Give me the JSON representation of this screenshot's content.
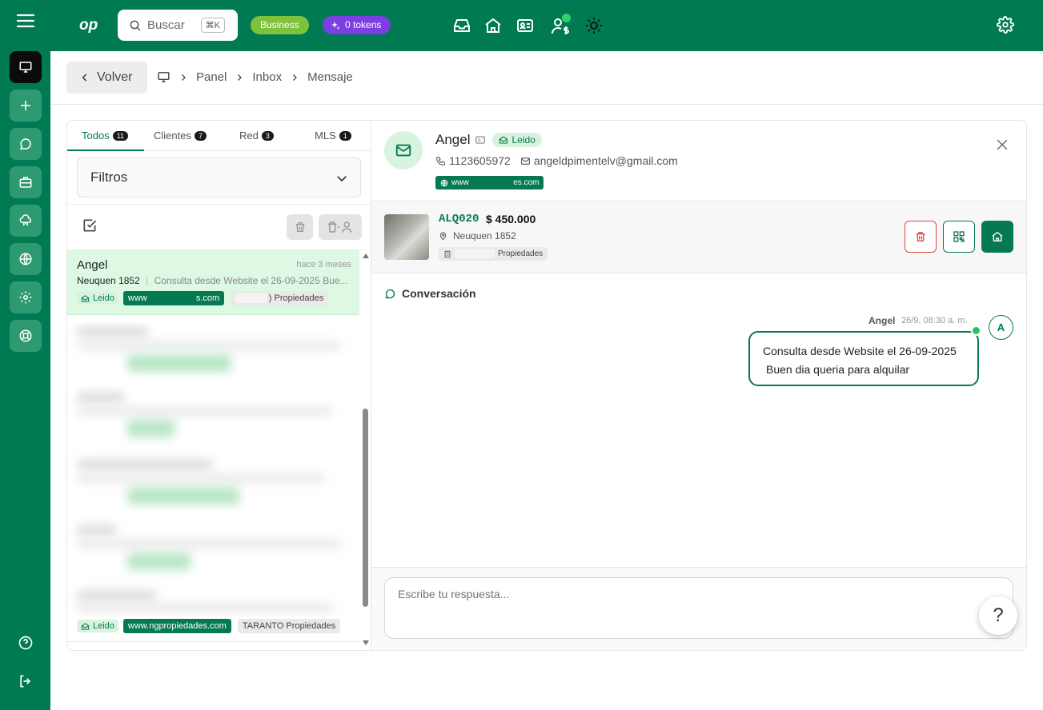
{
  "topbar": {
    "search_placeholder": "Buscar",
    "search_shortcut": "⌘K",
    "plan_badge": "Business",
    "tokens_badge": "0 tokens"
  },
  "breadcrumb": {
    "back_label": "Volver",
    "items": [
      "Panel",
      "Inbox",
      "Mensaje"
    ]
  },
  "inbox": {
    "tabs": [
      {
        "label": "Todos",
        "count": "11"
      },
      {
        "label": "Clientes",
        "count": "7"
      },
      {
        "label": "Red",
        "count": "3"
      },
      {
        "label": "MLS",
        "count": "1"
      }
    ],
    "filters_label": "Filtros",
    "selected_message": {
      "name": "Angel",
      "time": "hace 3 meses",
      "property": "Neuquen 1852",
      "preview": "Consulta desde Website el 26-09-2025 Bue...",
      "status": "Leido",
      "website": "www                    s.com",
      "agency": ") Propiedades"
    },
    "last_row": {
      "status": "Leido",
      "website": "www.ngpropiedades.com",
      "agency": "TARANTO Propiedades"
    }
  },
  "detail": {
    "contact": {
      "name": "Angel",
      "status": "Leido",
      "phone": "1123605972",
      "email": "angeldpimentelv@gmail.com",
      "website": "www                    es.com"
    },
    "property": {
      "code": "ALQ020",
      "price": "$ 450.000",
      "location": "Neuquen 1852",
      "agency": "Propiedades"
    },
    "conversation_title": "Conversación",
    "message": {
      "sender": "Angel",
      "time": "26/9, 08:30 a. m.",
      "avatar_initial": "A",
      "line1": "Consulta desde Website el 26-09-2025",
      "line2": "Buen dia queria para alquilar"
    },
    "reply_placeholder": "Escribe tu respuesta..."
  },
  "help_label": "?",
  "colors": {
    "brand": "#007a52",
    "accent_purple": "#7b3fe4",
    "accent_lime": "#7ec23a",
    "danger": "#e0443c"
  }
}
